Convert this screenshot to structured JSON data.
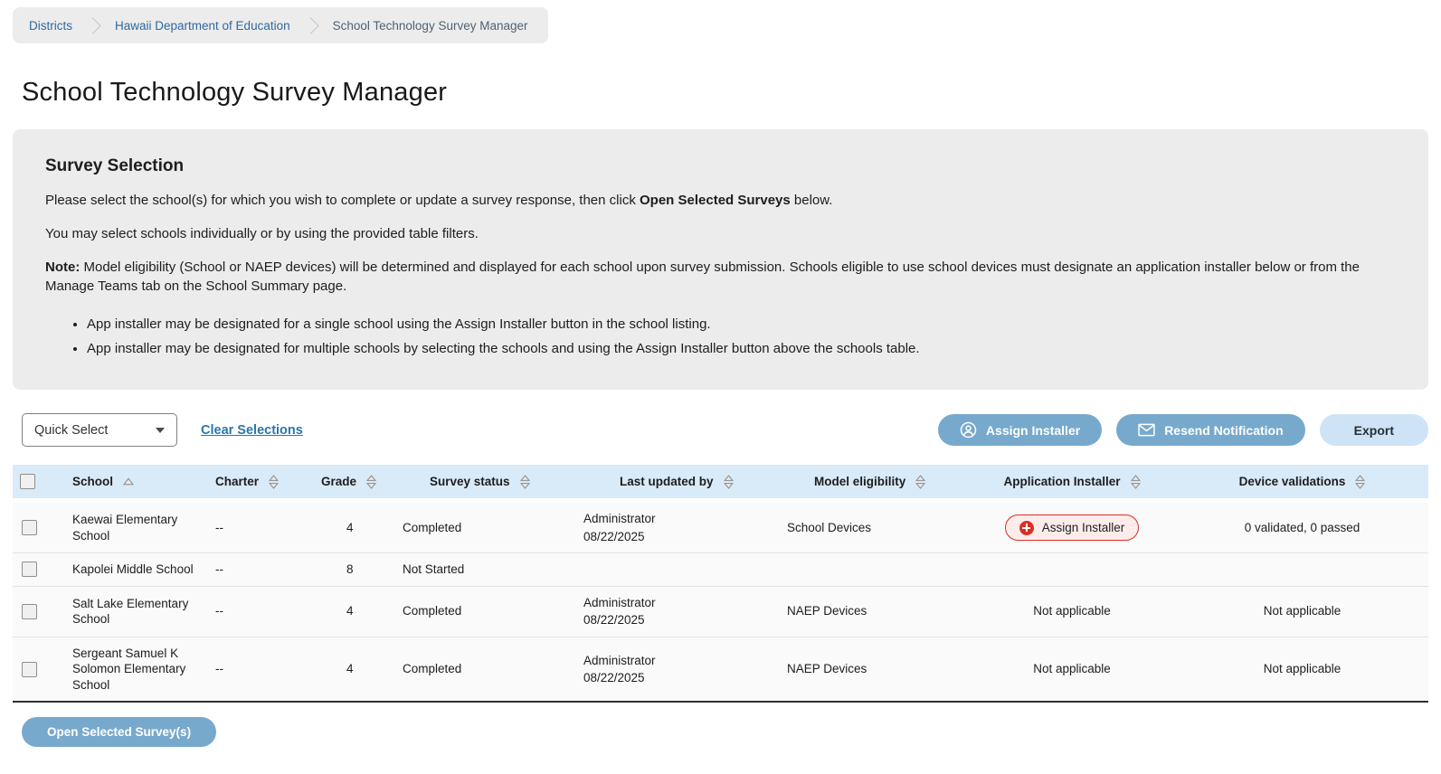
{
  "breadcrumb": {
    "items": [
      {
        "label": "Districts"
      },
      {
        "label": "Hawaii Department of Education"
      },
      {
        "label": "School Technology Survey Manager"
      }
    ]
  },
  "page_title": "School Technology Survey Manager",
  "panel": {
    "title": "Survey Selection",
    "p1_before": "Please select the school(s) for which you wish to complete or update a survey response, then click ",
    "p1_bold": "Open Selected Surveys",
    "p1_after": " below.",
    "p2": "You may select schools individually or by using the provided table filters.",
    "note_label": "Note:",
    "note_text": " Model eligibility (School or NAEP devices) will be determined and displayed for each school upon survey submission. Schools eligible to use school devices must designate an application installer below or from the Manage Teams tab on the School Summary page.",
    "bullets": [
      "App installer may be designated for a single school using the Assign Installer button in the school listing.",
      "App installer may be designated for multiple schools by selecting the schools and using the Assign Installer button above the schools table."
    ]
  },
  "toolbar": {
    "quick_select_label": "Quick Select",
    "clear_selections_label": "Clear Selections",
    "assign_installer_label": "Assign Installer",
    "resend_notification_label": "Resend Notification",
    "export_label": "Export"
  },
  "table": {
    "columns": [
      "School",
      "Charter",
      "Grade",
      "Survey status",
      "Last updated by",
      "Model eligibility",
      "Application Installer",
      "Device validations"
    ],
    "sort": {
      "column": "School",
      "direction": "asc"
    },
    "rows": [
      {
        "school": "Kaewai Elementary School",
        "charter": "--",
        "grade": "4",
        "survey_status": "Completed",
        "last_updated_by": "Administrator",
        "last_updated_date": "08/22/2025",
        "model_eligibility": "School Devices",
        "application_installer": "Assign Installer",
        "device_validations": "0 validated, 0 passed"
      },
      {
        "school": "Kapolei Middle School",
        "charter": "--",
        "grade": "8",
        "survey_status": "Not Started",
        "last_updated_by": "",
        "last_updated_date": "",
        "model_eligibility": "",
        "application_installer": "",
        "device_validations": ""
      },
      {
        "school": "Salt Lake Elementary School",
        "charter": "--",
        "grade": "4",
        "survey_status": "Completed",
        "last_updated_by": "Administrator",
        "last_updated_date": "08/22/2025",
        "model_eligibility": "NAEP Devices",
        "application_installer": "Not applicable",
        "device_validations": "Not applicable"
      },
      {
        "school": "Sergeant Samuel K Solomon Elementary School",
        "charter": "--",
        "grade": "4",
        "survey_status": "Completed",
        "last_updated_by": "Administrator",
        "last_updated_date": "08/22/2025",
        "model_eligibility": "NAEP Devices",
        "application_installer": "Not applicable",
        "device_validations": "Not applicable"
      }
    ]
  },
  "footer": {
    "open_selected_label": "Open Selected Survey(s)"
  },
  "icons": {
    "breadcrumb_separator": "chevron-right",
    "quick_select": "caret-down",
    "assign_installer": "person-circle",
    "resend_notification": "envelope",
    "row_assign_installer": "plus-circle",
    "sorted_asc": "triangle-up",
    "sortable": "triangle-up-down"
  },
  "colors": {
    "accent_steel_blue": "#77a9cd",
    "export_light_blue": "#cfe3f7",
    "table_header_blue": "#d9eaf8",
    "panel_gray": "#ececec",
    "link_blue": "#2a76ad",
    "breadcrumb_link_blue": "#2d6a9f",
    "danger_red": "#d93025",
    "danger_pill_bg": "#fdecea",
    "row_bg": "#fafafa"
  }
}
